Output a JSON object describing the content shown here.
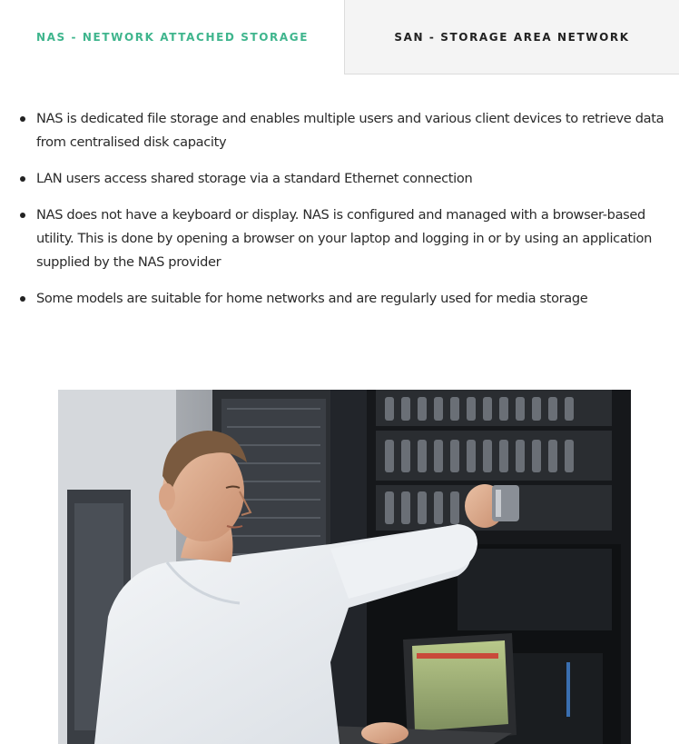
{
  "tabs": [
    {
      "label": "NAS - NETWORK ATTACHED STORAGE",
      "active": true
    },
    {
      "label": "SAN - STORAGE AREA NETWORK",
      "active": false
    }
  ],
  "bullets": [
    "NAS is dedicated file storage and enables multiple users and various client devices to retrieve data from centralised disk capacity",
    "LAN users access shared storage via a standard Ethernet connection",
    "NAS does not have a keyboard or display. NAS is configured and managed with a browser-based utility. This is done by opening a browser on your laptop and logging in or by using an application supplied by the NAS provider",
    "Some models are suitable for home networks and are regularly used for media storage"
  ],
  "colors": {
    "active_tab": "#3fb58d",
    "inactive_tab_bg": "#f4f4f4",
    "text": "#2a2a2a"
  }
}
